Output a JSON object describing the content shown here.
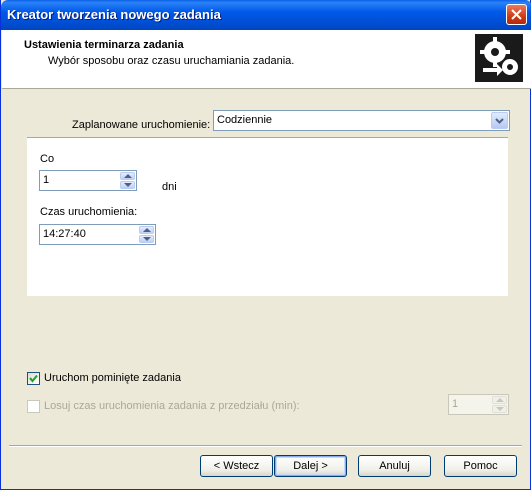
{
  "window": {
    "title": "Kreator tworzenia nowego zadania"
  },
  "header": {
    "title": "Ustawienia terminarza zadania",
    "subtitle": "Wybór sposobu oraz czasu uruchamiania zadania."
  },
  "schedule": {
    "label": "Zaplanowane uruchomienie:",
    "value": "Codziennie"
  },
  "daily": {
    "every_label": "Co",
    "every_value": "1",
    "unit_label": "dni",
    "start_label": "Czas uruchomienia:",
    "start_value": "14:27:40"
  },
  "options": {
    "run_missed_label": "Uruchom pominięte zadania",
    "run_missed_checked": true,
    "random_delay_label": "Losuj czas uruchomienia zadania z przedziału (min):",
    "random_delay_checked": false,
    "random_delay_value": "1"
  },
  "buttons": {
    "back": "< Wstecz",
    "next": "Dalej >",
    "cancel": "Anuluj",
    "help": "Pomoc"
  },
  "colors": {
    "titlebar": "#0054E3",
    "dialog_bg": "#ECE9D8",
    "accent": "#21A121"
  }
}
